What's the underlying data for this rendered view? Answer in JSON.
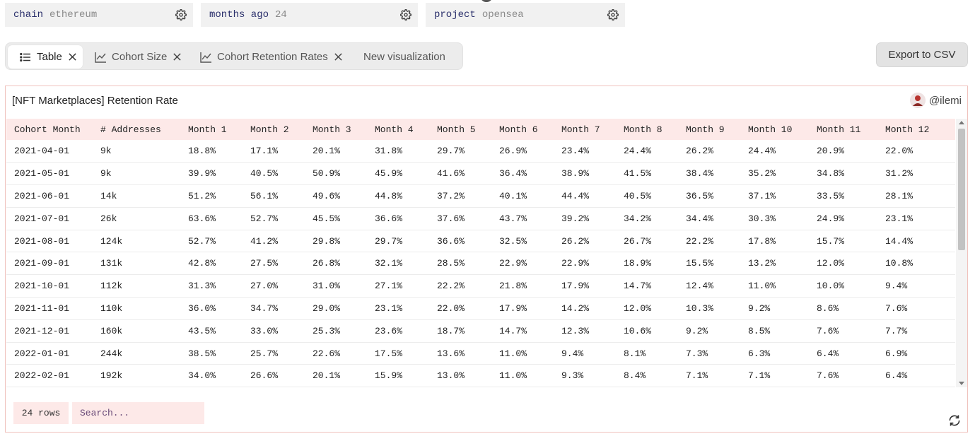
{
  "params": [
    {
      "name": "chain",
      "value": "ethereum"
    },
    {
      "name": "months ago",
      "value": "24"
    },
    {
      "name": "project",
      "value": "opensea"
    }
  ],
  "tabs": [
    {
      "label": "Table",
      "icon": "list-icon",
      "active": true,
      "closable": true
    },
    {
      "label": "Cohort Size",
      "icon": "chart-line-icon",
      "active": false,
      "closable": true
    },
    {
      "label": "Cohort Retention Rates",
      "icon": "chart-line-icon",
      "active": false,
      "closable": true
    },
    {
      "label": "New visualization",
      "icon": "",
      "active": false,
      "closable": false
    }
  ],
  "export_label": "Export to CSV",
  "card": {
    "title": "[NFT Marketplaces] Retention Rate",
    "author": "@ilemi"
  },
  "table": {
    "columns": [
      "Cohort Month",
      "# Addresses",
      "Month 1",
      "Month 2",
      "Month 3",
      "Month 4",
      "Month 5",
      "Month 6",
      "Month 7",
      "Month 8",
      "Month 9",
      "Month 10",
      "Month 11",
      "Month 12"
    ],
    "rows": [
      [
        "2021-04-01",
        "9k",
        "18.8%",
        "17.1%",
        "20.1%",
        "31.8%",
        "29.7%",
        "26.9%",
        "23.4%",
        "24.4%",
        "26.2%",
        "24.4%",
        "20.9%",
        "22.0%"
      ],
      [
        "2021-05-01",
        "9k",
        "39.9%",
        "40.5%",
        "50.9%",
        "45.9%",
        "41.6%",
        "36.4%",
        "38.9%",
        "41.5%",
        "38.4%",
        "35.2%",
        "34.8%",
        "31.2%"
      ],
      [
        "2021-06-01",
        "14k",
        "51.2%",
        "56.1%",
        "49.6%",
        "44.8%",
        "37.2%",
        "40.1%",
        "44.4%",
        "40.5%",
        "36.5%",
        "37.1%",
        "33.5%",
        "28.1%"
      ],
      [
        "2021-07-01",
        "26k",
        "63.6%",
        "52.7%",
        "45.5%",
        "36.6%",
        "37.6%",
        "43.7%",
        "39.2%",
        "34.2%",
        "34.4%",
        "30.3%",
        "24.9%",
        "23.1%"
      ],
      [
        "2021-08-01",
        "124k",
        "52.7%",
        "41.2%",
        "29.8%",
        "29.7%",
        "36.6%",
        "32.5%",
        "26.2%",
        "26.7%",
        "22.2%",
        "17.8%",
        "15.7%",
        "14.4%"
      ],
      [
        "2021-09-01",
        "131k",
        "42.8%",
        "27.5%",
        "26.8%",
        "32.1%",
        "28.5%",
        "22.9%",
        "22.9%",
        "18.9%",
        "15.5%",
        "13.2%",
        "12.0%",
        "10.8%"
      ],
      [
        "2021-10-01",
        "112k",
        "31.3%",
        "27.0%",
        "31.0%",
        "27.1%",
        "22.2%",
        "21.8%",
        "17.9%",
        "14.7%",
        "12.4%",
        "11.0%",
        "10.0%",
        "9.4%"
      ],
      [
        "2021-11-01",
        "110k",
        "36.0%",
        "34.7%",
        "29.0%",
        "23.1%",
        "22.0%",
        "17.9%",
        "14.2%",
        "12.0%",
        "10.3%",
        "9.2%",
        "8.6%",
        "7.6%"
      ],
      [
        "2021-12-01",
        "160k",
        "43.5%",
        "33.0%",
        "25.3%",
        "23.6%",
        "18.7%",
        "14.7%",
        "12.3%",
        "10.6%",
        "9.2%",
        "8.5%",
        "7.6%",
        "7.7%"
      ],
      [
        "2022-01-01",
        "244k",
        "38.5%",
        "25.7%",
        "22.6%",
        "17.5%",
        "13.6%",
        "11.0%",
        "9.4%",
        "8.1%",
        "7.3%",
        "6.3%",
        "6.4%",
        "6.9%"
      ],
      [
        "2022-02-01",
        "192k",
        "34.0%",
        "26.6%",
        "20.1%",
        "15.9%",
        "13.0%",
        "11.0%",
        "9.3%",
        "8.4%",
        "7.1%",
        "7.1%",
        "7.6%",
        "6.4%"
      ]
    ]
  },
  "footer": {
    "rows_label": "24 rows",
    "search_placeholder": "Search..."
  },
  "colors": {
    "accent_light": "#fde9e8",
    "card_border": "#f0c2bd",
    "param_name": "#2a2f6b"
  }
}
